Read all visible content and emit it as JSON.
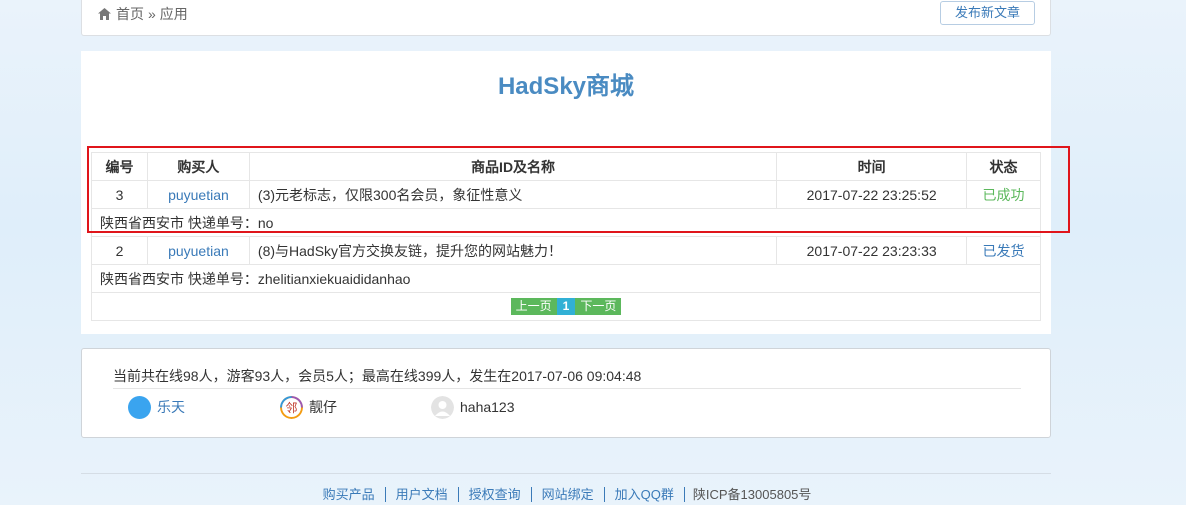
{
  "breadcrumb": {
    "home": "首页",
    "sep": "»",
    "current": "应用"
  },
  "toolbar": {
    "publish_label": "发布新文章"
  },
  "main": {
    "title": "HadSky商城"
  },
  "table": {
    "headers": [
      "编号",
      "购买人",
      "商品ID及名称",
      "时间",
      "状态"
    ],
    "orders": [
      {
        "id": "3",
        "buyer": "puyuetian",
        "goods": "(3)元老标志，仅限300名会员，象征性意义",
        "time": "2017-07-22 23:25:52",
        "status": "已成功",
        "address": "陕西省西安市 快递单号：no"
      },
      {
        "id": "2",
        "buyer": "puyuetian",
        "goods": "(8)与HadSky官方交换友链，提升您的网站魅力！",
        "time": "2017-07-22 23:23:33",
        "status": "已发货",
        "address": "陕西省西安市 快递单号：zhelitianxiekuaididanhao"
      }
    ],
    "pager": {
      "prev": "上一页",
      "current": "1",
      "next": "下一页"
    }
  },
  "online": {
    "summary": "当前共在线98人，游客93人，会员5人；最高在线399人，发生在2017-07-06 09:04:48",
    "users": [
      {
        "name": "乐天",
        "avatar_icon": "blue-circle-avatar"
      },
      {
        "name": "靓仔",
        "avatar_icon": "colorful-badge-avatar"
      },
      {
        "name": "haha123",
        "avatar_icon": "default-gray-avatar"
      }
    ]
  },
  "footer": {
    "links": [
      "购买产品",
      "用户文档",
      "授权查询",
      "网站绑定",
      "加入QQ群"
    ],
    "icp": "陕ICP备13005805号"
  },
  "colors": {
    "accent": "#4a8bc2",
    "link": "#3a7ab8",
    "success": "#5cb85c",
    "highlight": "#e0151b"
  }
}
